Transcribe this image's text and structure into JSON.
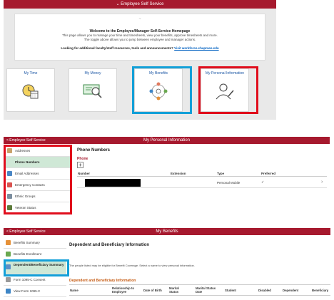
{
  "ess": {
    "header": "⌄ Employee Self Service",
    "logo_text": "~",
    "welcome_title": "Welcome to the Employee/Manager Self-Service Homepage",
    "welcome_line1": "This page allows you to manage your time and timesheets, view your benefits, approve timesheets and more.",
    "welcome_line2": "The toggle above allows you to jump between employee and manager actions.",
    "question": "Looking for additional faculty/staff resources, tools and announcements?",
    "link": "Visit workforce.chapman.edu",
    "tiles": [
      {
        "label": "My Time",
        "icon": "clock-calendar-icon"
      },
      {
        "label": "My Money",
        "icon": "money-magnifier-icon"
      },
      {
        "label": "My Benefits",
        "icon": "benefits-people-icon"
      },
      {
        "label": "My Personal Information",
        "icon": "person-edit-icon"
      }
    ]
  },
  "personal": {
    "back_label": "< Employee Self Service",
    "title": "My Personal Information",
    "sidebar": [
      {
        "label": "Addresses",
        "selected": false
      },
      {
        "label": "Phone Numbers",
        "selected": true
      },
      {
        "label": "Email Addresses",
        "selected": false
      },
      {
        "label": "Emergency Contacts",
        "selected": false
      },
      {
        "label": "Ethnic Groups",
        "selected": false
      },
      {
        "label": "Veteran Status",
        "selected": false
      }
    ],
    "section_title": "Phone Numbers",
    "sub_title": "Phone",
    "add_symbol": "+",
    "columns": [
      "Number",
      "Extension",
      "Type",
      "Preferred"
    ],
    "row": {
      "type": "Personal Mobile",
      "preferred": "✓",
      "chevron": "›"
    }
  },
  "benefits": {
    "back_label": "< Employee Self Service",
    "title": "My Benefits",
    "sidebar": [
      {
        "label": "Benefits Summary",
        "selected": false
      },
      {
        "label": "Benefits Enrollment",
        "selected": false
      },
      {
        "label": "Dependent/Beneficiary Summary",
        "selected": true
      },
      {
        "label": "Form 1095-C Consent",
        "selected": false
      },
      {
        "label": "View Form 1095-C",
        "selected": false
      }
    ],
    "section_title": "Dependent and Beneficiary Information",
    "note": "The people listed may be eligible for Benefit Coverage. Select a name to view personal information.",
    "table_title": "Dependent and Beneficiary Information",
    "columns": [
      "Name",
      "Relationship to Employee",
      "Date of Birth",
      "Marital Status",
      "Marital Status Date",
      "Student",
      "Disabled",
      "Dependent",
      "Beneficiary"
    ]
  },
  "colors": {
    "brand": "#a6192e",
    "highlight_blue": "#13a0d8",
    "highlight_red": "#e00d1c",
    "selected_bg": "#cfe8d6"
  }
}
